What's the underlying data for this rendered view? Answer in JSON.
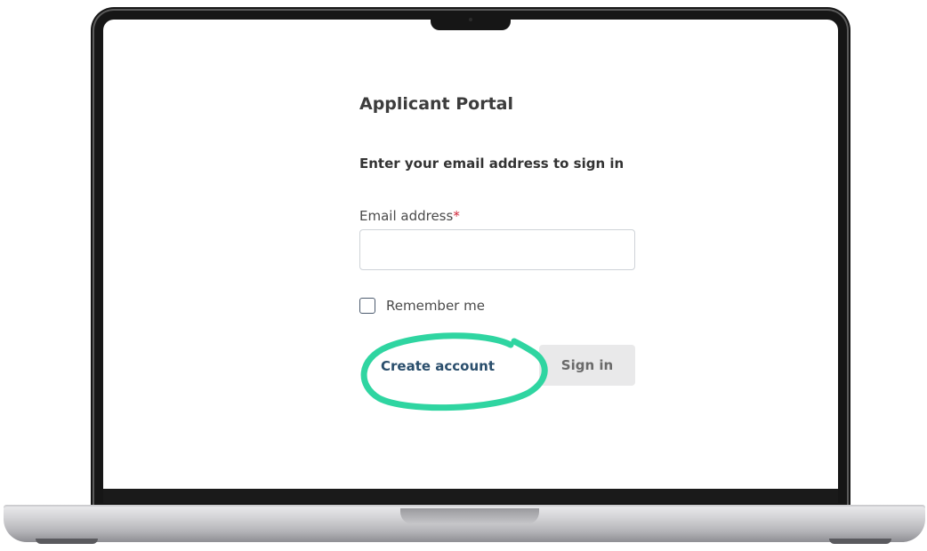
{
  "portal": {
    "title": "Applicant Portal",
    "heading": "Enter your email address to sign in"
  },
  "email": {
    "label": "Email address",
    "required_mark": "*",
    "value": ""
  },
  "remember": {
    "label": "Remember me",
    "checked": false
  },
  "actions": {
    "create_account": "Create account",
    "sign_in": "Sign in"
  },
  "colors": {
    "highlight": "#2fd5a1",
    "required": "#d0283a",
    "link": "#2a4e6c",
    "sign_in_bg": "#e9e9ea"
  }
}
